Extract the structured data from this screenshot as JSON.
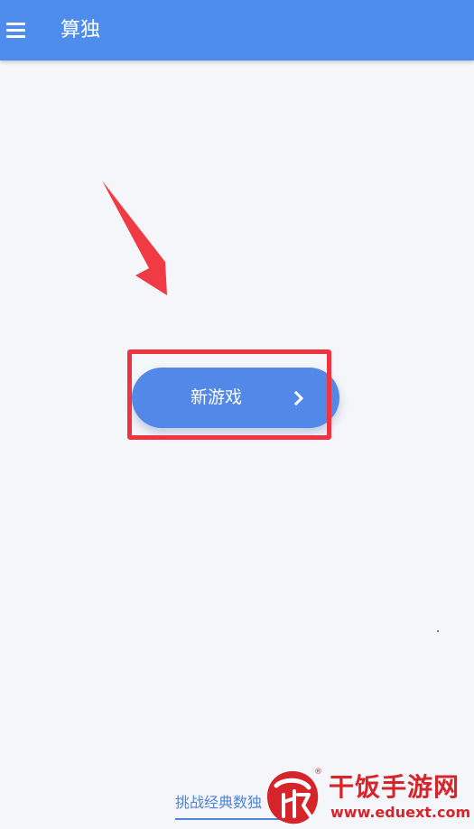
{
  "app": {
    "title": "算独"
  },
  "main": {
    "new_game_label": "新游戏",
    "challenge_link": "挑战经典数独"
  },
  "watermark": {
    "brand": "干饭手游网",
    "url": "www.eduext.com",
    "logo_char": "饭",
    "registered": "®"
  },
  "colors": {
    "appbar": "#4f8ded",
    "button": "#5289e8",
    "highlight": "#ef3340",
    "arrow": "#f03a44",
    "background": "#f5f6fa",
    "watermark": "#d6242b"
  },
  "icons": {
    "menu": "hamburger-menu-icon",
    "chevron": "chevron-right-icon",
    "annotation": "red-arrow-annotation"
  }
}
